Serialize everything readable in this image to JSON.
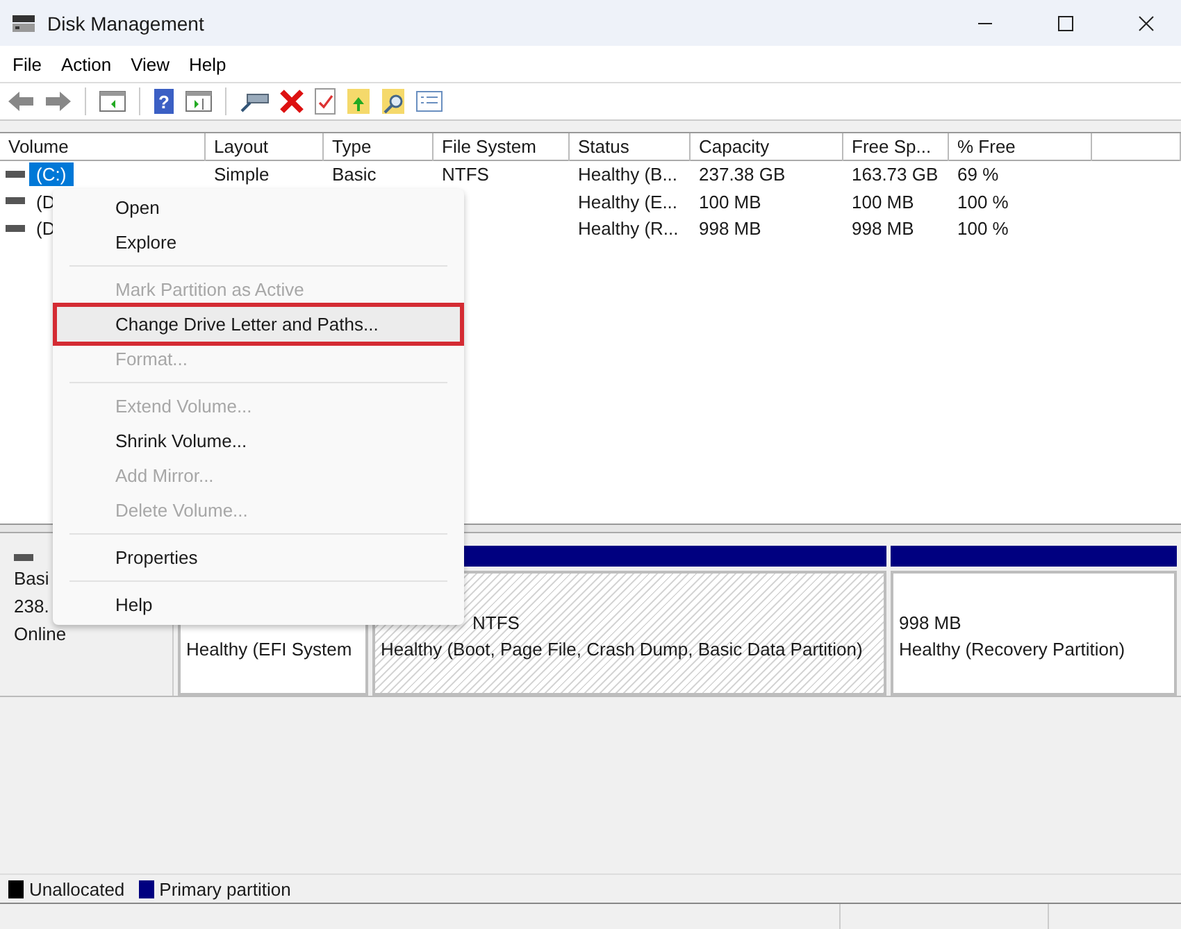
{
  "window": {
    "title": "Disk Management"
  },
  "menu_bar": [
    "File",
    "Action",
    "View",
    "Help"
  ],
  "toolbar": [
    {
      "kind": "back"
    },
    {
      "kind": "forward"
    },
    {
      "kind": "sep"
    },
    {
      "kind": "tree"
    },
    {
      "kind": "sep"
    },
    {
      "kind": "help",
      "label": "?"
    },
    {
      "kind": "pane"
    },
    {
      "kind": "sep"
    },
    {
      "kind": "drive"
    },
    {
      "kind": "delete"
    },
    {
      "kind": "check"
    },
    {
      "kind": "folder-up"
    },
    {
      "kind": "folder-search"
    },
    {
      "kind": "list"
    }
  ],
  "table": {
    "columns": [
      "Volume",
      "Layout",
      "Type",
      "File System",
      "Status",
      "Capacity",
      "Free Sp...",
      "% Free"
    ],
    "rows": [
      {
        "selected": true,
        "cells": [
          "(C:)",
          "Simple",
          "Basic",
          "NTFS",
          "Healthy (B...",
          "237.38 GB",
          "163.73 GB",
          "69 %"
        ]
      },
      {
        "selected": false,
        "cells": [
          "(D",
          null,
          null,
          null,
          "Healthy (E...",
          "100 MB",
          "100 MB",
          "100 %"
        ]
      },
      {
        "selected": false,
        "cells": [
          "(D",
          null,
          null,
          null,
          "Healthy (R...",
          "998 MB",
          "998 MB",
          "100 %"
        ]
      }
    ]
  },
  "disk": {
    "info": [
      "Basi",
      "238.",
      "Online"
    ],
    "partitions": [
      {
        "selected": false,
        "bar": false,
        "lines": [
          "Healthy (EFI System"
        ]
      },
      {
        "selected": true,
        "bar": true,
        "lines": [
          "NTFS",
          "Healthy (Boot, Page File, Crash Dump, Basic Data Partition)"
        ]
      },
      {
        "selected": false,
        "bar": true,
        "lines": [
          "998 MB",
          "Healthy (Recovery Partition)"
        ]
      }
    ]
  },
  "context_menu": [
    {
      "kind": "item",
      "label": "Open",
      "disabled": false,
      "highlighted": false
    },
    {
      "kind": "item",
      "label": "Explore",
      "disabled": false,
      "highlighted": false
    },
    {
      "kind": "separator"
    },
    {
      "kind": "item",
      "label": "Mark Partition as Active",
      "disabled": true,
      "highlighted": false
    },
    {
      "kind": "item",
      "label": "Change Drive Letter and Paths...",
      "disabled": false,
      "highlighted": true
    },
    {
      "kind": "item",
      "label": "Format...",
      "disabled": true,
      "highlighted": false
    },
    {
      "kind": "separator"
    },
    {
      "kind": "item",
      "label": "Extend Volume...",
      "disabled": true,
      "highlighted": false
    },
    {
      "kind": "item",
      "label": "Shrink Volume...",
      "disabled": false,
      "highlighted": false
    },
    {
      "kind": "item",
      "label": "Add Mirror...",
      "disabled": true,
      "highlighted": false
    },
    {
      "kind": "item",
      "label": "Delete Volume...",
      "disabled": true,
      "highlighted": false
    },
    {
      "kind": "separator"
    },
    {
      "kind": "item",
      "label": "Properties",
      "disabled": false,
      "highlighted": false
    },
    {
      "kind": "separator"
    },
    {
      "kind": "item",
      "label": "Help",
      "disabled": false,
      "highlighted": false
    }
  ],
  "legend": [
    {
      "label": "Unallocated",
      "color": "#000000"
    },
    {
      "label": "Primary partition",
      "color": "#000080"
    }
  ]
}
